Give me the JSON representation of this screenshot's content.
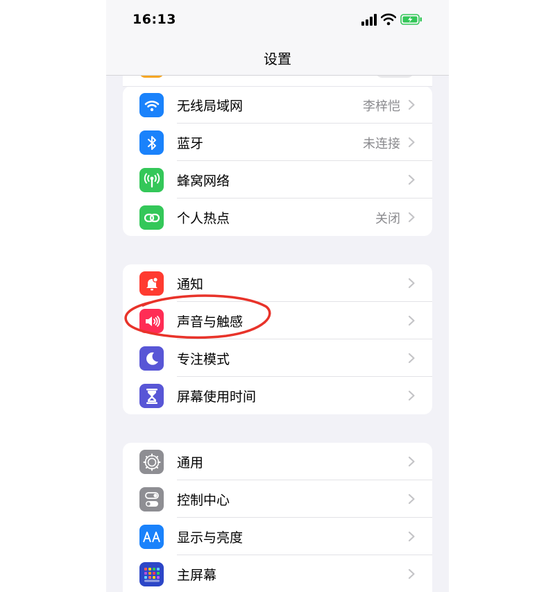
{
  "status_bar": {
    "time": "16:13"
  },
  "nav": {
    "title": "设置"
  },
  "groups": [
    {
      "items": [
        {
          "label": "无线局域网",
          "value": "李梓恺",
          "icon": "wifi-icon",
          "color": "#1a82fb"
        },
        {
          "label": "蓝牙",
          "value": "未连接",
          "icon": "bluetooth-icon",
          "color": "#1a82fb"
        },
        {
          "label": "蜂窝网络",
          "value": "",
          "icon": "cellular-icon",
          "color": "#34c759"
        },
        {
          "label": "个人热点",
          "value": "关闭",
          "icon": "hotspot-icon",
          "color": "#34c759"
        }
      ]
    },
    {
      "items": [
        {
          "label": "通知",
          "value": "",
          "icon": "bell-icon",
          "color": "#ff3b30"
        },
        {
          "label": "声音与触感",
          "value": "",
          "icon": "speaker-icon",
          "color": "#ff2d55"
        },
        {
          "label": "专注模式",
          "value": "",
          "icon": "moon-icon",
          "color": "#5856d6"
        },
        {
          "label": "屏幕使用时间",
          "value": "",
          "icon": "hourglass-icon",
          "color": "#5856d6"
        }
      ]
    },
    {
      "items": [
        {
          "label": "通用",
          "value": "",
          "icon": "gear-icon",
          "color": "#8e8e93"
        },
        {
          "label": "控制中心",
          "value": "",
          "icon": "toggles-icon",
          "color": "#8e8e93"
        },
        {
          "label": "显示与亮度",
          "value": "",
          "icon": "text-size-icon",
          "color": "#1a82fb"
        },
        {
          "label": "主屏幕",
          "value": "",
          "icon": "home-grid-icon",
          "color": "#2c46c7"
        }
      ]
    }
  ],
  "annotation": {
    "color": "#e8332a"
  }
}
